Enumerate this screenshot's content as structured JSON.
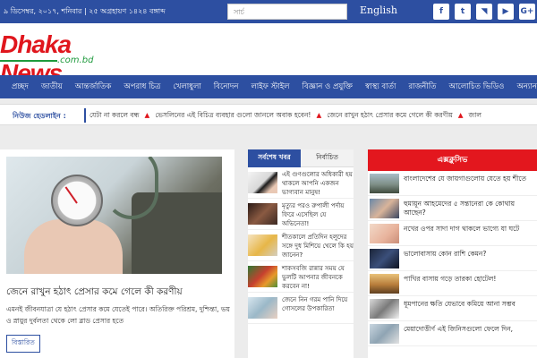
{
  "topbar": {
    "date": "৯ ডিসেম্বর, ২০১৭, শনিবার | ২৫ অগ্রহায়ণ ১৪২৪ বঙ্গাব্দ",
    "search_placeholder": "সার্চ",
    "english_label": "English",
    "socials": [
      {
        "icon": "facebook-icon",
        "glyph": "f"
      },
      {
        "icon": "twitter-icon",
        "glyph": "t"
      },
      {
        "icon": "rss-icon",
        "glyph": "◥"
      },
      {
        "icon": "youtube-icon",
        "glyph": "▶"
      },
      {
        "icon": "google-plus-icon",
        "glyph": "G+"
      }
    ]
  },
  "logo": {
    "text_main": "Dhaka News",
    "text_sub": ".com.bd"
  },
  "nav": {
    "items": [
      "প্রচ্ছদ",
      "জাতীয়",
      "আন্তর্জাতিক",
      "অপরাধ চিত্র",
      "খেলাধুলা",
      "বিনোদন",
      "লাইফ স্টাইল",
      "বিজ্ঞান ও প্রযুক্তি",
      "স্বাস্থ্য বার্তা",
      "রাজনীতি",
      "আলোচিত ভিডিও",
      "অন্যান্য"
    ]
  },
  "ticker": {
    "label": "নিউজ হেডলাইন :",
    "items": [
      "যেটা না করলে বন্ধ",
      "ভেসলিনের এই বিচিত্র ব্যবহার গুলো জানলে অবাক হবেন!",
      "জেনে রাখুন হঠাৎ প্রেসার কমে গেলে কী করণীয়",
      "জাল"
    ]
  },
  "feature": {
    "title": "জেনে রাখুন হঠাৎ প্রেসার কমে গেলে কী করণীয়",
    "desc": "এমনই জীবনযাত্রা যে হঠাৎ প্রেসার কমে যেতেই পারে। অতিরিক্ত পরিশ্রম, দুশ্চিন্তা, ভয় ও স্নায়ুর দুর্বলতা থেকে লো ব্লাড প্রেসার হতে",
    "more_label": "বিস্তারিত"
  },
  "latest": {
    "tabs": [
      "সর্বশেষ খবর",
      "নির্বাচিত"
    ],
    "items": [
      "এই গুণগুলোর অধিকারী হয় থাকলে আপনি একজন ভাগ্যবান মানুষ!",
      "মৃত্যুর পরও রুপালী পর্দায় ফিরে এসেছিল যে অভিনেতা!",
      "শীতকালে প্রতিদিন হলুদের সঙ্গে দুধ মিশিয়ে খেলে কি হয় জানেন?",
      "শাকসবজি রান্নার সময় যে ভুলটি আপনার জীবনকে করবেন না!",
      "জেনে নিন গরম পানি দিয়ে গোসলের উপকারিতা"
    ]
  },
  "exclusive": {
    "heading": "এক্সক্লুসিভ",
    "items": [
      "বাংলাদেশের যে জায়গাগুলোয় যেতে হয় শীতে",
      "হুমায়ূন আহমেদের ৫ সন্তানেরা কে কোথায় আছেন?",
      "নখের ওপর সাদা দাগ থাকলে ভাগ্যে যা ঘটে",
      "ভালোবাসায় কোন রাশি কেমন?",
      "পাখির বাসায় গড়ে তারকা হোটেল!",
      "ধূমপানের ক্ষতি যেভাবে কমিয়ে আনা সম্ভব",
      "মেয়াদোত্তীর্ণ এই জিনিসগুলো ফেলে দিন,"
    ]
  }
}
